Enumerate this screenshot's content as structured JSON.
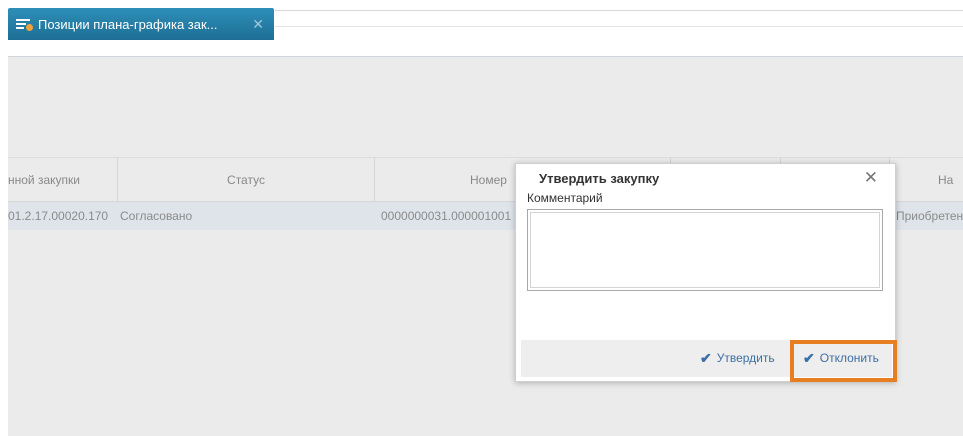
{
  "tab": {
    "title": "Позиции плана-графика зак...",
    "icon": "document-add-icon",
    "close": "✕"
  },
  "grid": {
    "headers": [
      "нной закупки",
      "Статус",
      "Номер",
      "",
      "",
      "На"
    ],
    "row": [
      "01.2.17.00020.170",
      "Согласовано",
      "0000000031.000001001",
      "Приобретен"
    ]
  },
  "dialog": {
    "title": "Утвердить закупку",
    "close": "✕",
    "comment_label": "Комментарий",
    "comment_value": "",
    "approve_label": "Утвердить",
    "reject_label": "Отклонить"
  },
  "colors": {
    "accent": "#e67e22",
    "tab": "#1d6f95",
    "link": "#3d6fa3"
  }
}
